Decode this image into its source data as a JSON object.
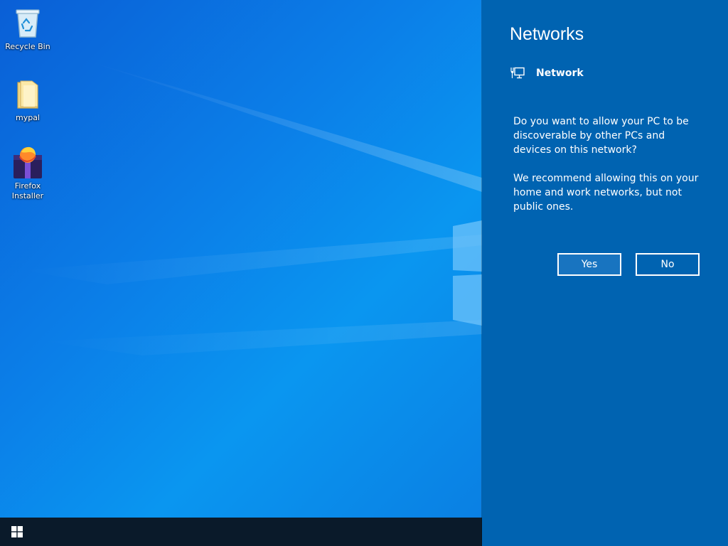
{
  "desktop": {
    "icons": [
      {
        "label": "Recycle Bin",
        "icon": "recycle-bin-icon"
      },
      {
        "label": "mypal",
        "icon": "folder-icon"
      },
      {
        "label": "Firefox Installer",
        "icon": "firefox-installer-icon"
      }
    ]
  },
  "taskbar": {
    "start_icon": "windows-logo-icon"
  },
  "networks_panel": {
    "title": "Networks",
    "network_name": "Network",
    "network_icon": "wired-network-icon",
    "question": "Do you want to allow your PC to be discoverable by other PCs and devices on this network?",
    "recommendation": "We recommend allowing this on your home and work networks, but not public ones.",
    "yes_label": "Yes",
    "no_label": "No"
  },
  "colors": {
    "panel_background": "#0063b1",
    "taskbar_background": "#0a1a2a",
    "text": "#ffffff"
  }
}
